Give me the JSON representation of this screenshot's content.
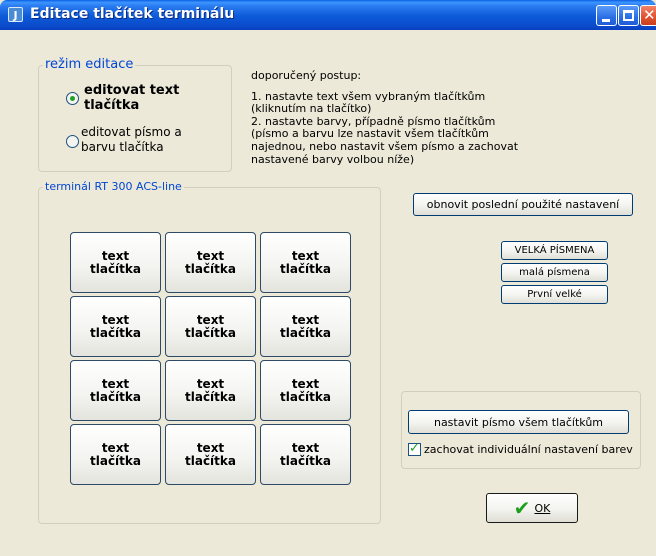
{
  "window": {
    "title": "Editace tlačítek terminálu",
    "app_icon_letter": "J"
  },
  "mode": {
    "legend": "režim editace",
    "options": [
      {
        "label": "editovat text\ntlačítka",
        "selected": true
      },
      {
        "label": "editovat písmo a\nbarvu tlačítka",
        "selected": false
      }
    ]
  },
  "instructions": {
    "heading": "doporučený postup:",
    "lines": [
      "1. nastavte text všem vybraným tlačítkům",
      "(kliknutím na tlačítko)",
      "2. nastavte barvy, případně písmo tlačítkům",
      "(písmo a barvu lze nastavit všem tlačítkům",
      "najednou, nebo nastavit všem písmo a zachovat",
      "nastavené barvy volbou níže)"
    ]
  },
  "terminal": {
    "legend": "terminál RT 300 ACS-line",
    "key_label": "text\ntlačítka"
  },
  "buttons": {
    "restore": "obnovit poslední použité nastavení",
    "uppercase": "VELKÁ PÍSMENA",
    "lowercase": "malá písmena",
    "capitalize": "První velké",
    "set_font": "nastavit písmo všem tlačítkům",
    "ok": "OK"
  },
  "keep_colors": {
    "label": "zachovat individuální nastavení barev",
    "checked": true
  },
  "colors": {
    "titlebar": "#0a4ccc",
    "legend_text": "#0046d5",
    "window_bg": "#ece9d8",
    "accent_green": "#21a121"
  },
  "icons": {
    "ok_icon": "checkmark-icon"
  }
}
